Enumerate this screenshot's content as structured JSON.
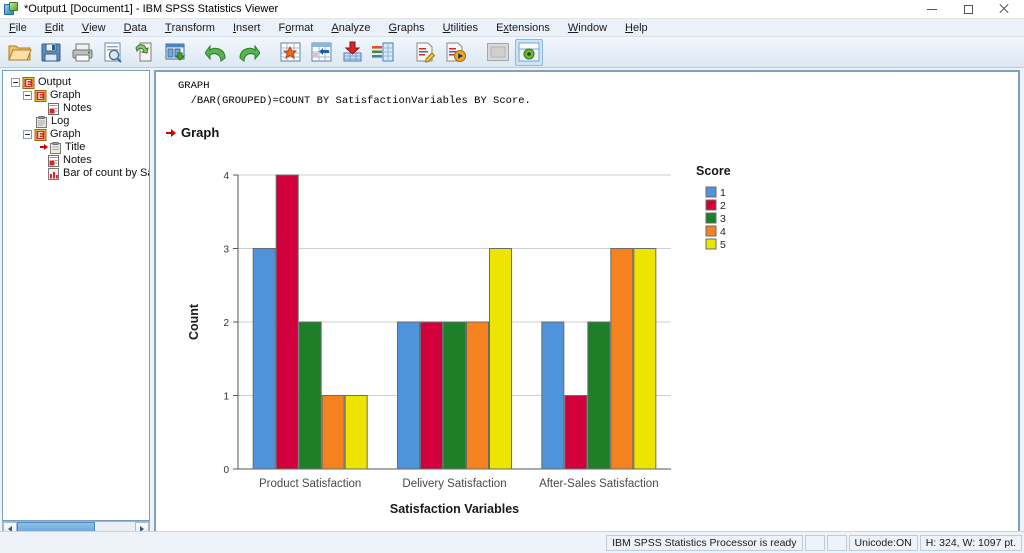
{
  "window": {
    "title": "*Output1 [Document1] - IBM SPSS Statistics Viewer",
    "app_icon": "spss-viewer-icon",
    "minimize_label": "Minimize",
    "restore_label": "Restore",
    "close_label": "Close"
  },
  "menubar": {
    "items": [
      {
        "label": "File",
        "mnemonic": "F"
      },
      {
        "label": "Edit",
        "mnemonic": "E"
      },
      {
        "label": "View",
        "mnemonic": "V"
      },
      {
        "label": "Data",
        "mnemonic": "D"
      },
      {
        "label": "Transform",
        "mnemonic": "T"
      },
      {
        "label": "Insert",
        "mnemonic": "I"
      },
      {
        "label": "Format",
        "mnemonic": "o"
      },
      {
        "label": "Analyze",
        "mnemonic": "A"
      },
      {
        "label": "Graphs",
        "mnemonic": "G"
      },
      {
        "label": "Utilities",
        "mnemonic": "U"
      },
      {
        "label": "Extensions",
        "mnemonic": "x"
      },
      {
        "label": "Window",
        "mnemonic": "W"
      },
      {
        "label": "Help",
        "mnemonic": "H"
      }
    ]
  },
  "toolbar": {
    "buttons": [
      {
        "name": "open-file-icon",
        "tip": "Open"
      },
      {
        "name": "save-icon",
        "tip": "Save"
      },
      {
        "name": "print-icon",
        "tip": "Print"
      },
      {
        "name": "print-preview-icon",
        "tip": "Print Preview"
      },
      {
        "name": "recall-dialog-icon",
        "tip": "Recall recently used dialogs"
      },
      {
        "name": "export-icon",
        "tip": "Export"
      },
      {
        "name": "undo-icon",
        "tip": "Undo"
      },
      {
        "name": "redo-icon",
        "tip": "Redo"
      },
      {
        "name": "go-to-case-icon",
        "tip": "Go to case"
      },
      {
        "name": "go-to-data-icon",
        "tip": "Go to data"
      },
      {
        "name": "insert-icon",
        "tip": "Insert"
      },
      {
        "name": "variables-icon",
        "tip": "Variables"
      },
      {
        "name": "edit-syntax-icon",
        "tip": "Edit syntax"
      },
      {
        "name": "run-syntax-icon",
        "tip": "Run syntax"
      },
      {
        "name": "promote-icon",
        "tip": "Promote"
      },
      {
        "name": "demote-icon",
        "tip": "Demote"
      }
    ]
  },
  "outline": {
    "root_label": "Output",
    "items": [
      {
        "label": "Output",
        "icon": "output-icon",
        "depth": 0,
        "expander": "minus"
      },
      {
        "label": "Graph",
        "icon": "graph-node-icon",
        "depth": 1,
        "expander": "minus"
      },
      {
        "label": "Notes",
        "icon": "notes-icon",
        "depth": 2,
        "expander": "none"
      },
      {
        "label": "Log",
        "icon": "log-icon",
        "depth": 1,
        "expander": "none"
      },
      {
        "label": "Graph",
        "icon": "graph-node-icon",
        "depth": 1,
        "expander": "minus"
      },
      {
        "label": "Title",
        "icon": "title-icon",
        "depth": 2,
        "expander": "none",
        "marker": "red-arrow"
      },
      {
        "label": "Notes",
        "icon": "notes-icon",
        "depth": 2,
        "expander": "none"
      },
      {
        "label": "Bar of count by Sa",
        "icon": "bar-chart-icon",
        "depth": 2,
        "expander": "none"
      }
    ],
    "scrollbar": {
      "name": "outline-hscrollbar"
    }
  },
  "output": {
    "syntax_line1": "GRAPH",
    "syntax_line2": "  /BAR(GROUPED)=COUNT BY SatisfactionVariables BY Score.",
    "graph_heading": "Graph"
  },
  "chart_data": {
    "type": "bar",
    "title": "",
    "xlabel": "Satisfaction Variables",
    "ylabel": "Count",
    "categories": [
      "Product Satisfaction",
      "Delivery Satisfaction",
      "After-Sales Satisfaction"
    ],
    "legend_title": "Score",
    "legend_position": "right",
    "grid": true,
    "ylim": [
      0,
      4
    ],
    "yticks": [
      "0",
      "1",
      "2",
      "3",
      "4"
    ],
    "series": [
      {
        "name": "1",
        "color": "#4F93DB",
        "values": [
          3,
          2,
          2
        ]
      },
      {
        "name": "2",
        "color": "#D1003C",
        "values": [
          4,
          2,
          1
        ]
      },
      {
        "name": "3",
        "color": "#1F7F28",
        "values": [
          2,
          2,
          2
        ]
      },
      {
        "name": "4",
        "color": "#F5821F",
        "values": [
          1,
          2,
          3
        ]
      },
      {
        "name": "5",
        "color": "#EDE500",
        "values": [
          1,
          3,
          3
        ]
      }
    ]
  },
  "statusbar": {
    "processor_status": "IBM SPSS Statistics Processor is ready",
    "unicode_status": "Unicode:ON",
    "dimensions": "H: 324, W: 1097 pt."
  }
}
